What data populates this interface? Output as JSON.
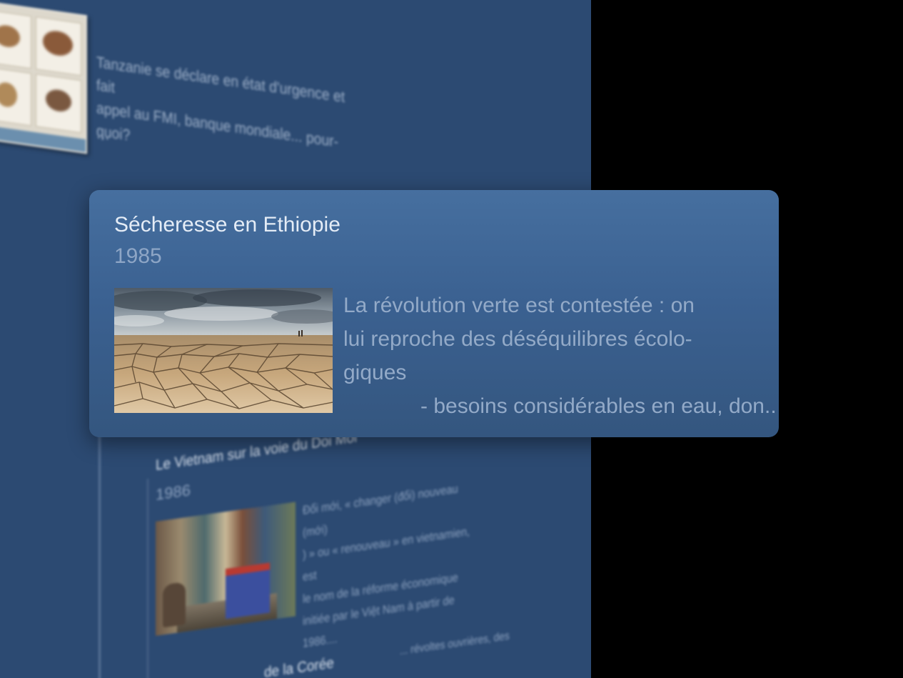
{
  "background_entries": {
    "tanzania": {
      "text_lines": [
        "Tanzanie se déclare en état d'urgence et fait",
        "appel au FMI, banque mondiale... pour-",
        "quoi?"
      ],
      "ellipsis": "..."
    },
    "vietnam": {
      "title": "Le Vietnam sur la voie du Doi Moi",
      "year": "1986",
      "text_lines": [
        "Đổi mới, « changer (đổi) nouveau (mới)",
        ") » ou « renouveau » en vietnamien, est",
        "le nom de la réforme économique",
        "initiée par le Việt Nam à partir de 1986...."
      ]
    },
    "korea": {
      "title": "de la Corée",
      "text": "... révoltes ouvrières, des"
    }
  },
  "focused_card": {
    "title": "Sécheresse en Ethiopie",
    "year": "1985",
    "image_icon": "cracked-dry-earth-photo",
    "text_lines": [
      "La révolution verte est contestée : on",
      "lui reproche des déséquilibres écolo-",
      "giques",
      "- besoins considérables en eau, don.."
    ]
  },
  "colors": {
    "panel_bg": "#2c4a72",
    "card_bg": "#3b6191",
    "outer_bg": "#000000"
  }
}
